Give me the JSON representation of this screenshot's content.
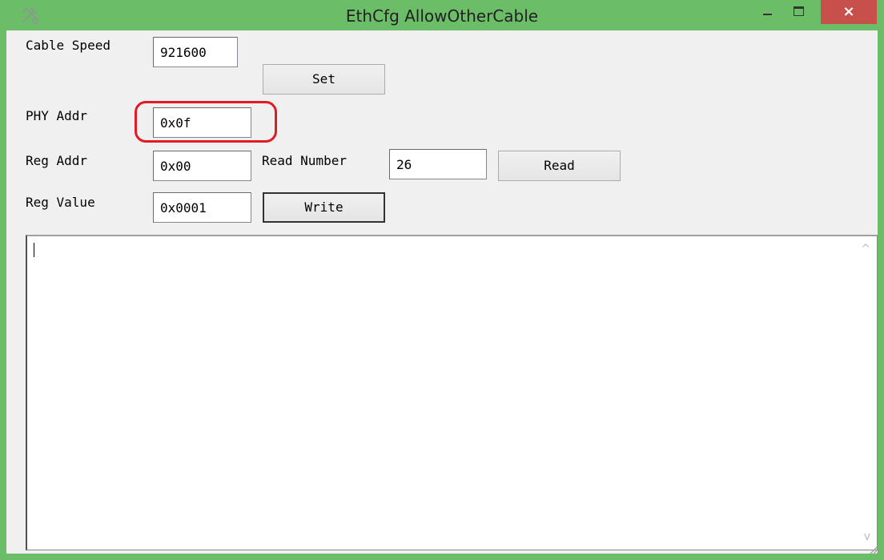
{
  "window": {
    "title": "EthCfg AllowOtherCable",
    "app_icon": "tools-icon",
    "minimize_icon": "minimize-icon",
    "maximize_icon": "maximize-icon",
    "close_icon": "close-icon",
    "close_glyph": "×",
    "colors": {
      "frame": "#6cbd68",
      "close": "#c7504b",
      "highlight": "#e01b24"
    }
  },
  "form": {
    "cable_speed": {
      "label": "Cable Speed",
      "value": "921600",
      "button": "Set"
    },
    "phy_addr": {
      "label": "PHY Addr",
      "value": "0x0f"
    },
    "reg_addr": {
      "label": "Reg Addr",
      "value": "0x00"
    },
    "read_number": {
      "label": "Read Number",
      "value": "26",
      "button": "Read"
    },
    "reg_value": {
      "label": "Reg Value",
      "value": "0x0001",
      "button": "Write"
    }
  },
  "output": {
    "text": "",
    "scroll_up_glyph": "^",
    "scroll_down_glyph": "v"
  }
}
